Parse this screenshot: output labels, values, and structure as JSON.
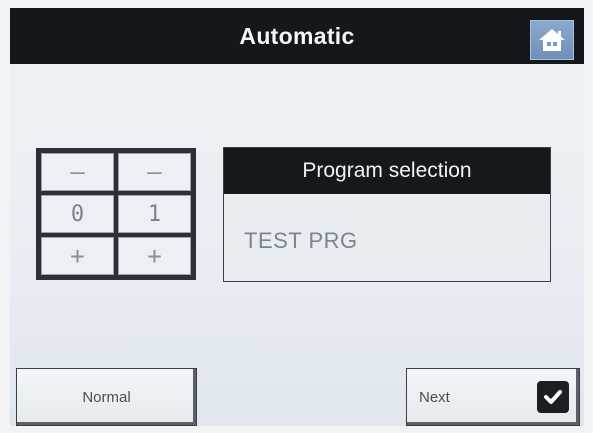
{
  "header": {
    "title": "Automatic",
    "home_icon": "home-icon"
  },
  "counter": {
    "minus_label": "—",
    "plus_label": "+",
    "digits": [
      "0",
      "1"
    ]
  },
  "program": {
    "header": "Program selection",
    "value": "TEST PRG"
  },
  "buttons": {
    "normal_label": "Normal",
    "next_label": "Next",
    "next_icon": "checkmark-icon"
  },
  "colors": {
    "titlebar": "#14171b",
    "home_button": "#7c9bc4",
    "background": "#eef2f6"
  }
}
